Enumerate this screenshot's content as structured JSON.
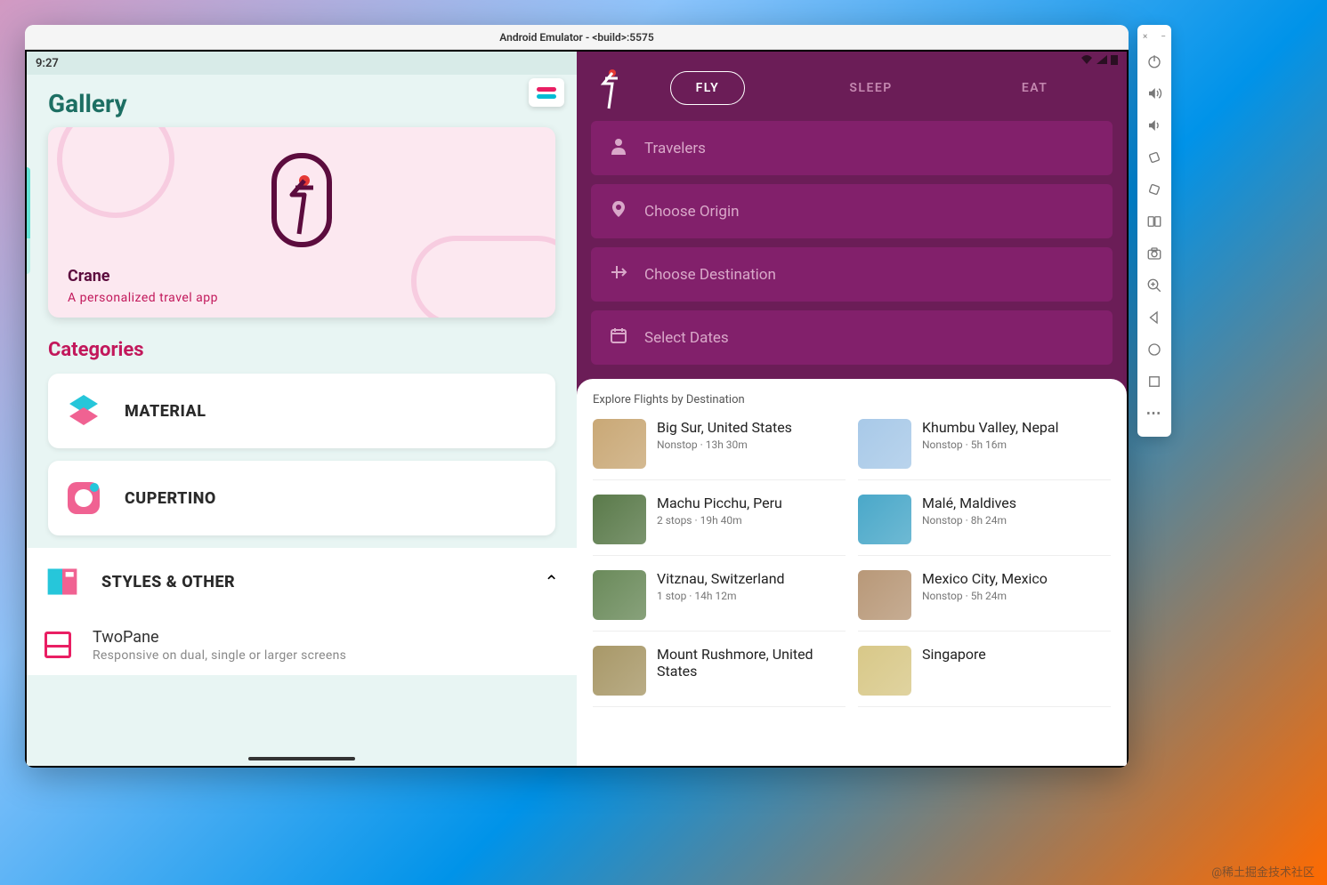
{
  "window": {
    "title": "Android Emulator - <build>:5575"
  },
  "status": {
    "time": "9:27"
  },
  "gallery": {
    "title": "Gallery",
    "crane": {
      "name": "Crane",
      "tagline": "A personalized travel app"
    },
    "categories_label": "Categories",
    "categories": [
      {
        "label": "MATERIAL"
      },
      {
        "label": "CUPERTINO"
      }
    ],
    "styles": {
      "label": "STYLES & OTHER",
      "items": [
        {
          "title": "TwoPane",
          "subtitle": "Responsive on dual, single or larger screens"
        }
      ]
    }
  },
  "crane_app": {
    "tabs": [
      {
        "label": "FLY",
        "active": true
      },
      {
        "label": "SLEEP",
        "active": false
      },
      {
        "label": "EAT",
        "active": false
      }
    ],
    "fields": [
      {
        "icon": "person",
        "label": "Travelers"
      },
      {
        "icon": "pin",
        "label": "Choose Origin"
      },
      {
        "icon": "plane",
        "label": "Choose Destination"
      },
      {
        "icon": "calendar",
        "label": "Select Dates"
      }
    ],
    "results_title": "Explore Flights by Destination",
    "destinations": [
      {
        "name": "Big Sur, United States",
        "detail": "Nonstop · 13h 30m",
        "thumb": "#c9a876"
      },
      {
        "name": "Khumbu Valley, Nepal",
        "detail": "Nonstop · 5h 16m",
        "thumb": "#a8c9e8"
      },
      {
        "name": "Machu Picchu, Peru",
        "detail": "2 stops · 19h 40m",
        "thumb": "#5a7a4a"
      },
      {
        "name": "Malé, Maldives",
        "detail": "Nonstop · 8h 24m",
        "thumb": "#4aa8c9"
      },
      {
        "name": "Vitznau, Switzerland",
        "detail": "1 stop · 14h 12m",
        "thumb": "#6a8a5a"
      },
      {
        "name": "Mexico City, Mexico",
        "detail": "Nonstop · 5h 24m",
        "thumb": "#b89878"
      },
      {
        "name": "Mount Rushmore, United States",
        "detail": "",
        "thumb": "#a89868"
      },
      {
        "name": "Singapore",
        "detail": "",
        "thumb": "#d8c888"
      }
    ]
  },
  "watermark": "@稀土掘金技术社区"
}
